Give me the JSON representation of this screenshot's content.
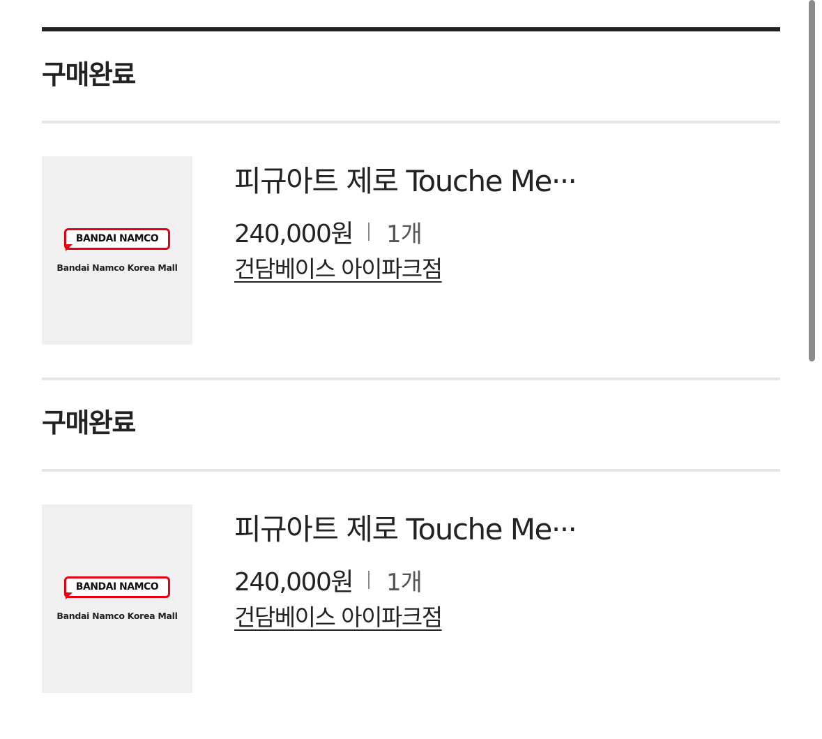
{
  "orders": [
    {
      "status": "구매완료",
      "thumbnail": {
        "logo_text": "BANDAI NAMCO",
        "caption": "Bandai Namco Korea Mall"
      },
      "product_name": "피규아트 제로 Touche Me···",
      "price": "240,000원",
      "quantity": "1개",
      "store": "건담베이스 아이파크점"
    },
    {
      "status": "구매완료",
      "thumbnail": {
        "logo_text": "BANDAI NAMCO",
        "caption": "Bandai Namco Korea Mall"
      },
      "product_name": "피규아트 제로 Touche Me···",
      "price": "240,000원",
      "quantity": "1개",
      "store": "건담베이스 아이파크점"
    }
  ],
  "colors": {
    "brand_red": "#e60012",
    "text": "#222222",
    "divider": "#e6e6e6",
    "thumb_bg": "#f0f0f0"
  }
}
